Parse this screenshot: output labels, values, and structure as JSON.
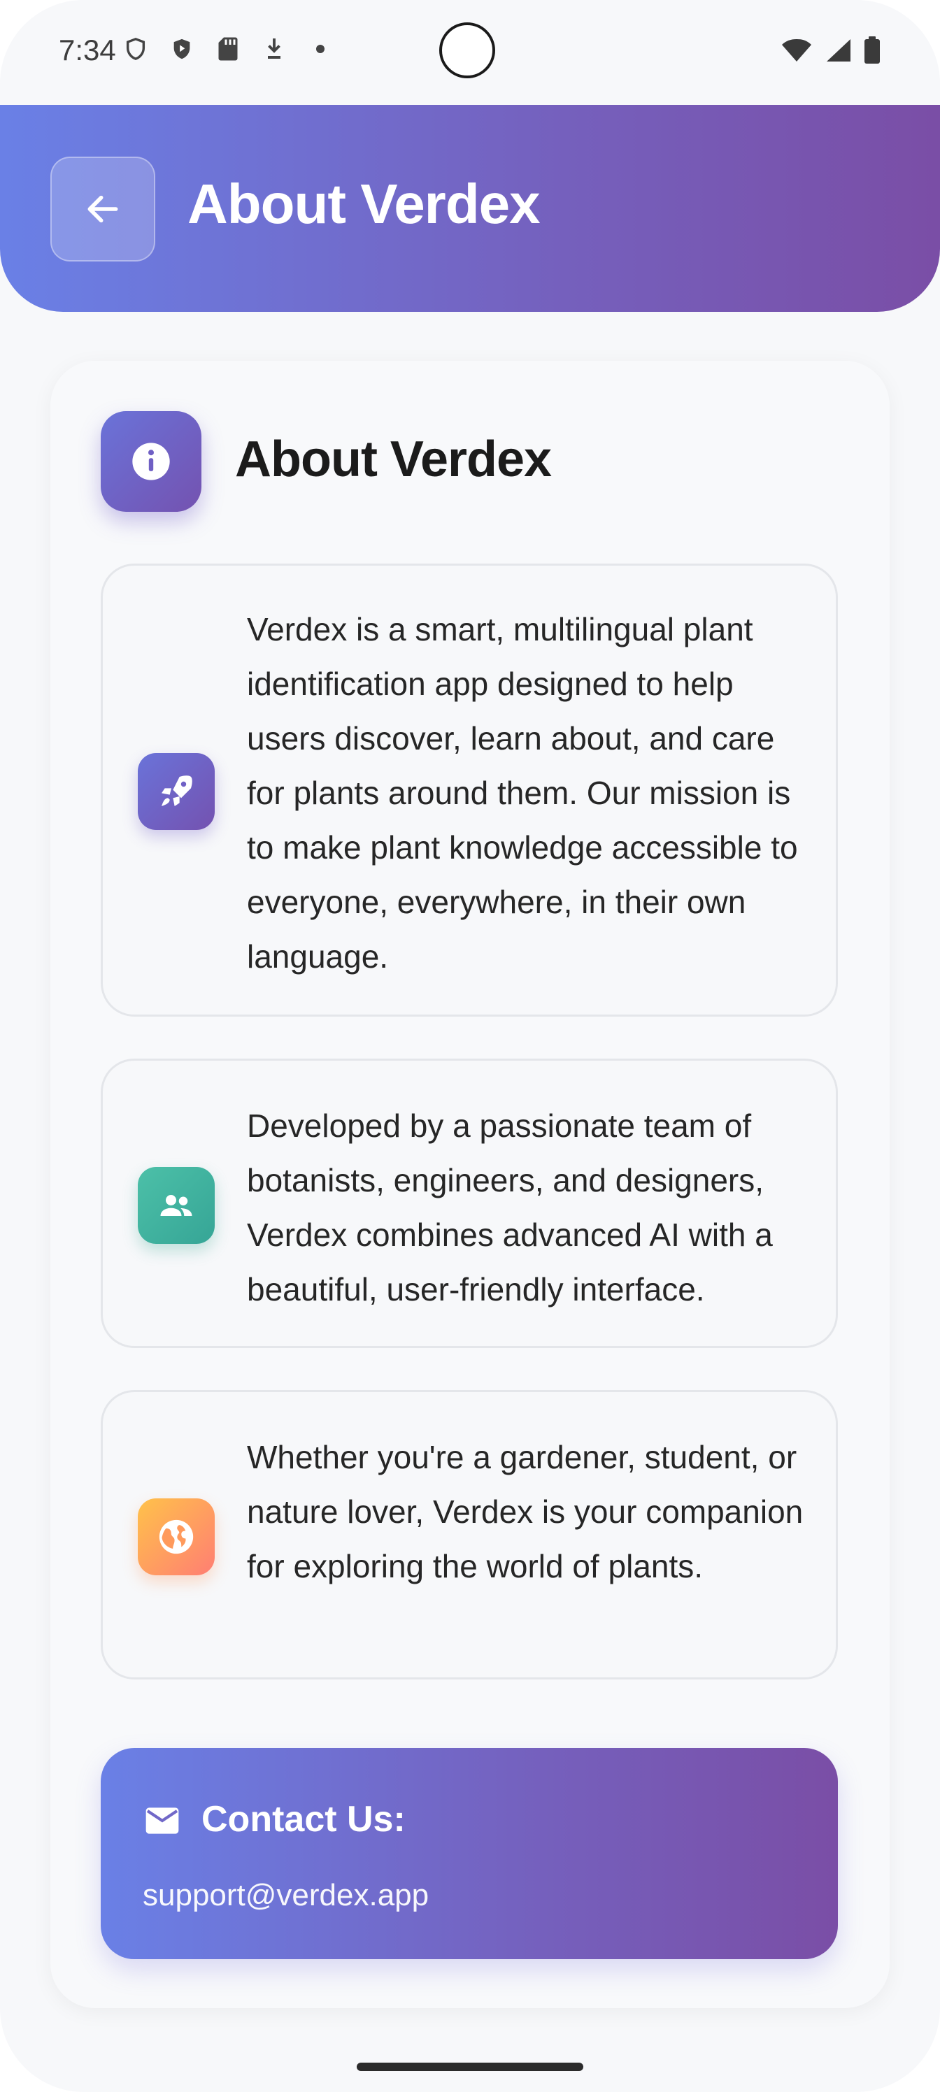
{
  "status_bar": {
    "time": "7:34"
  },
  "header": {
    "title": "About Verdex"
  },
  "card": {
    "title": "About Verdex",
    "sections": [
      {
        "icon": "rocket-icon",
        "color": "#6e5fc7",
        "text": "Verdex is a smart, multilingual plant identification app designed to help users discover, learn about, and care for plants around them. Our mission is to make plant knowledge accessible to everyone, everywhere, in their own language."
      },
      {
        "icon": "people-icon",
        "color": "#3fb2a2",
        "text": "Developed by a passionate team of botanists, engineers, and designers, Verdex combines advanced AI with a beautiful, user-friendly interface."
      },
      {
        "icon": "globe-icon",
        "color": "#ff9f5a",
        "text": "Whether you're a gardener, student, or nature lover, Verdex is your companion for exploring the world of plants."
      }
    ]
  },
  "contact": {
    "title": "Contact Us:",
    "email": "support@verdex.app"
  },
  "colors": {
    "accent_start": "#6a80e6",
    "accent_end": "#7a4ea6"
  }
}
